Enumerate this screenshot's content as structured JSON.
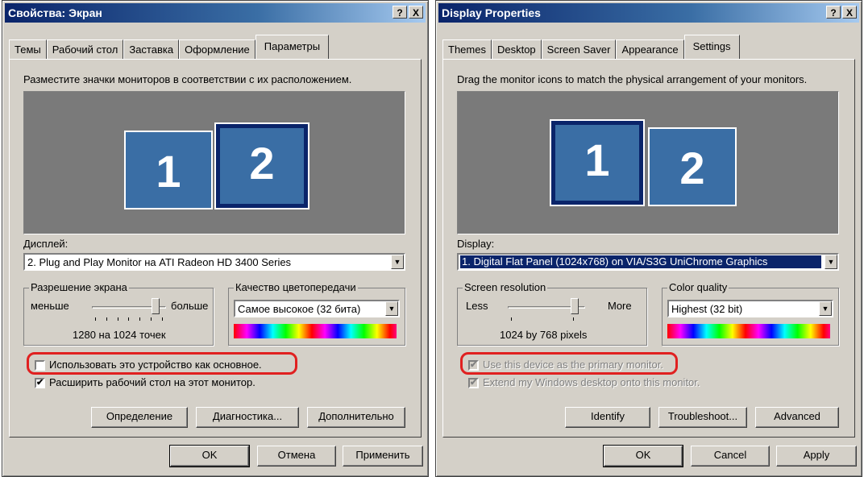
{
  "ru": {
    "title": "Свойства: Экран",
    "help_btn": "?",
    "close_btn": "X",
    "tabs": [
      "Темы",
      "Рабочий стол",
      "Заставка",
      "Оформление",
      "Параметры"
    ],
    "instruction": "Разместите значки мониторов в соответствии с их расположением.",
    "monitors": [
      "1",
      "2"
    ],
    "display_label": "Дисплей:",
    "display_value": "2. Plug and Play Monitor на ATI Radeon HD 3400 Series",
    "resolution_group": "Разрешение экрана",
    "less": "меньше",
    "more": "больше",
    "resolution_value": "1280 на 1024 точек",
    "color_group": "Качество цветопередачи",
    "color_value": "Самое высокое (32 бита)",
    "primary_checkbox": "Использовать это устройство как основное.",
    "primary_checked": false,
    "extend_checkbox": "Расширить рабочий стол на этот монитор.",
    "extend_checked": true,
    "btn_identify": "Определение",
    "btn_troubleshoot": "Диагностика...",
    "btn_advanced": "Дополнительно",
    "btn_ok": "OK",
    "btn_cancel": "Отмена",
    "btn_apply": "Применить"
  },
  "en": {
    "title": "Display Properties",
    "help_btn": "?",
    "close_btn": "X",
    "tabs": [
      "Themes",
      "Desktop",
      "Screen Saver",
      "Appearance",
      "Settings"
    ],
    "instruction": "Drag the monitor icons to match the physical arrangement of your monitors.",
    "monitors": [
      "1",
      "2"
    ],
    "display_label": "Display:",
    "display_value": "1. Digital Flat Panel (1024x768) on VIA/S3G UniChrome Graphics",
    "resolution_group": "Screen resolution",
    "less": "Less",
    "more": "More",
    "resolution_value": "1024 by 768 pixels",
    "color_group": "Color quality",
    "color_value": "Highest (32 bit)",
    "primary_checkbox": "Use this device as the primary monitor.",
    "primary_checked": true,
    "extend_checkbox": "Extend my Windows desktop onto this monitor.",
    "extend_checked": true,
    "btn_identify": "Identify",
    "btn_troubleshoot": "Troubleshoot...",
    "btn_advanced": "Advanced",
    "btn_ok": "OK",
    "btn_cancel": "Cancel",
    "btn_apply": "Apply"
  },
  "colors": {
    "title_bar": "#0a246a",
    "monitor_fill": "#3a6ea5",
    "highlight_ring": "#e02020",
    "dialog_bg": "#d4d0c8"
  }
}
